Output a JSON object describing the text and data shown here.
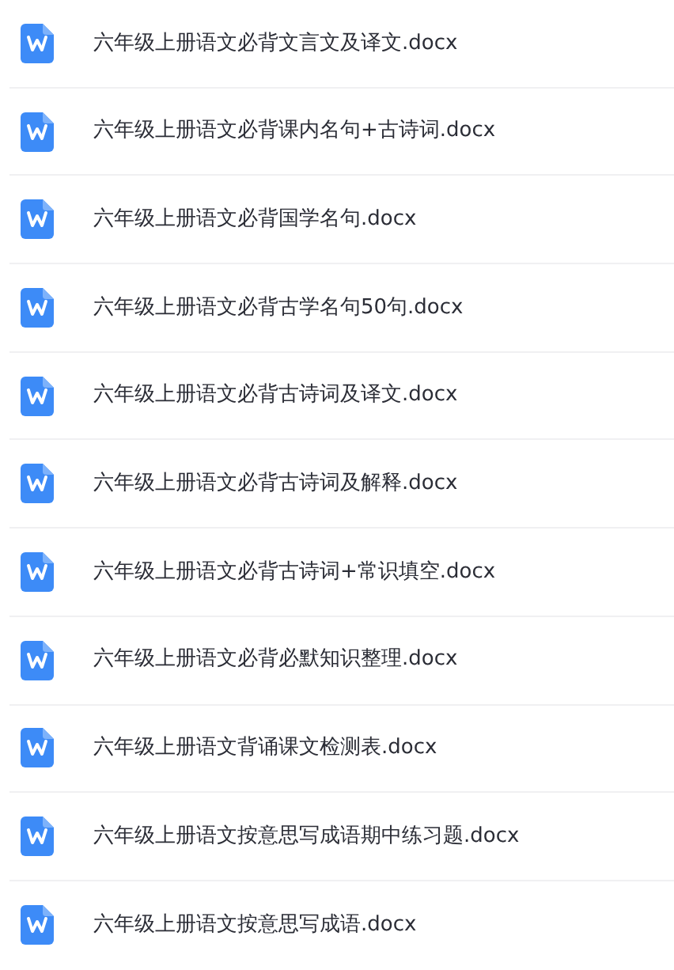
{
  "files": [
    {
      "name": "六年级上册语文必背文言文及译文.docx"
    },
    {
      "name": "六年级上册语文必背课内名句+古诗词.docx"
    },
    {
      "name": "六年级上册语文必背国学名句.docx"
    },
    {
      "name": "六年级上册语文必背古学名句50句.docx"
    },
    {
      "name": "六年级上册语文必背古诗词及译文.docx"
    },
    {
      "name": "六年级上册语文必背古诗词及解释.docx"
    },
    {
      "name": "六年级上册语文必背古诗词+常识填空.docx"
    },
    {
      "name": "六年级上册语文必背必默知识整理.docx"
    },
    {
      "name": "六年级上册语文背诵课文检测表.docx"
    },
    {
      "name": "六年级上册语文按意思写成语期中练习题.docx"
    },
    {
      "name": "六年级上册语文按意思写成语.docx"
    }
  ]
}
